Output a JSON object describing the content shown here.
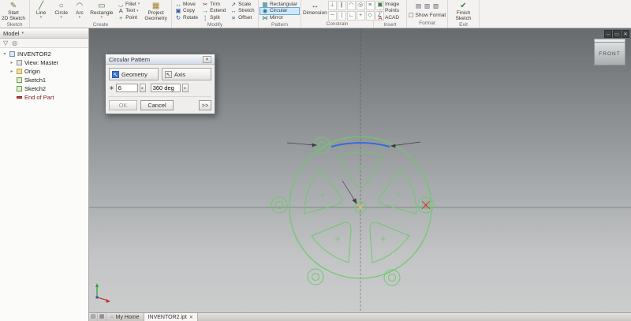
{
  "ribbon": {
    "groups": [
      {
        "label": "Sketch"
      },
      {
        "label": "Create"
      },
      {
        "label": "Modify"
      },
      {
        "label": "Pattern"
      },
      {
        "label": "Constrain"
      },
      {
        "label": "Insert"
      },
      {
        "label": "Format"
      },
      {
        "label": "Exit"
      }
    ],
    "buttons": {
      "start1": "Start",
      "start2": "2D Sketch",
      "line": "Line",
      "circle": "Circle",
      "arc": "Arc",
      "rectangle": "Rectangle",
      "fillet": "Fillet",
      "text": "Text",
      "point": "Point",
      "project1": "Project",
      "project2": "Geometry",
      "move": "Move",
      "copy": "Copy",
      "rotate": "Rotate",
      "trim": "Trim",
      "extend": "Extend",
      "split": "Split",
      "scale": "Scale",
      "stretch": "Stretch",
      "offset": "Offset",
      "rectangular": "Rectangular",
      "circular": "Circular",
      "mirror": "Mirror",
      "dimension": "Dimension",
      "image": "Image",
      "points": "Points",
      "acad": "ACAD",
      "show_format": "Show Format",
      "finish1": "Finish",
      "finish2": "Sketch"
    }
  },
  "browser": {
    "header": "Model",
    "items": [
      {
        "label": "INVENTOR2"
      },
      {
        "label": "View: Master"
      },
      {
        "label": "Origin"
      },
      {
        "label": "Sketch1"
      },
      {
        "label": "Sketch2"
      },
      {
        "label": "End of Part"
      }
    ]
  },
  "dialog": {
    "title": "Circular Pattern",
    "geometry": "Geometry",
    "axis": "Axis",
    "count": "6",
    "angle": "360 deg",
    "ok": "OK",
    "cancel": "Cancel",
    "more": ">>"
  },
  "viewcube": {
    "face": "FRONT"
  },
  "doc_controls": {
    "minimize": "–",
    "restore": "▭",
    "close": "✕"
  },
  "statusbar": {
    "tab_home": "My Home",
    "tab_doc": "INVENTOR2.ipt",
    "close": "✕"
  },
  "colors": {
    "sketch_green": "#6cc96c",
    "selection_blue": "#2f6fd6",
    "tool_highlight": "#cde8ff",
    "axis_red": "#cc3a3a"
  }
}
